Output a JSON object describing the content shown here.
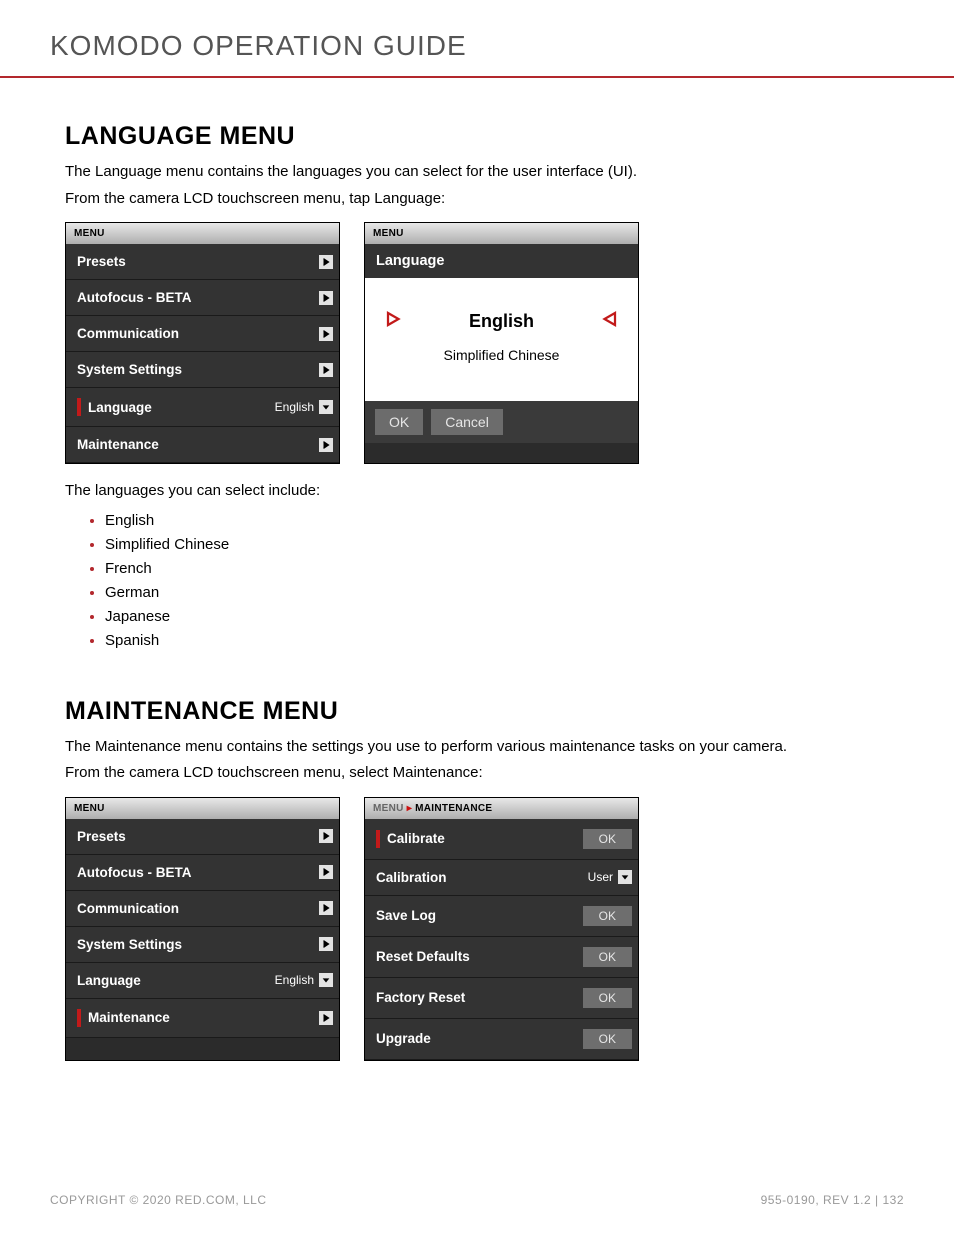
{
  "header": {
    "title": "KOMODO OPERATION GUIDE"
  },
  "section1": {
    "heading": "LANGUAGE MENU",
    "p1": "The Language menu contains the languages you can select for the user interface (UI).",
    "p2": "From the camera LCD touchscreen menu, tap Language:",
    "listIntro": "The languages you can select include:",
    "items": [
      "English",
      "Simplified Chinese",
      "French",
      "German",
      "Japanese",
      "Spanish"
    ]
  },
  "menuShot": {
    "header": "MENU",
    "rows": [
      {
        "label": "Presets",
        "type": "arrow",
        "selected": false
      },
      {
        "label": "Autofocus - BETA",
        "type": "arrow",
        "selected": false
      },
      {
        "label": "Communication",
        "type": "arrow",
        "selected": false
      },
      {
        "label": "System Settings",
        "type": "arrow",
        "selected": false
      },
      {
        "label": "Language",
        "type": "dropdown",
        "value": "English",
        "selected": true
      },
      {
        "label": "Maintenance",
        "type": "arrow",
        "selected": false
      }
    ]
  },
  "langDetail": {
    "header": "MENU",
    "title": "Language",
    "main": "English",
    "sub": "Simplified Chinese",
    "ok": "OK",
    "cancel": "Cancel"
  },
  "section2": {
    "heading": "MAINTENANCE MENU",
    "p1": "The Maintenance menu contains the settings you use to perform various maintenance tasks on your camera.",
    "p2": "From the camera LCD touchscreen menu, select Maintenance:"
  },
  "menuShot2": {
    "header": "MENU",
    "rows": [
      {
        "label": "Presets",
        "type": "arrow",
        "selected": false
      },
      {
        "label": "Autofocus - BETA",
        "type": "arrow",
        "selected": false
      },
      {
        "label": "Communication",
        "type": "arrow",
        "selected": false
      },
      {
        "label": "System Settings",
        "type": "arrow",
        "selected": false
      },
      {
        "label": "Language",
        "type": "dropdown",
        "value": "English",
        "selected": false
      },
      {
        "label": "Maintenance",
        "type": "arrow",
        "selected": true
      }
    ]
  },
  "maintDetail": {
    "crumbRoot": "MENU",
    "crumbLeaf": "MAINTENANCE",
    "rows": [
      {
        "label": "Calibrate",
        "type": "ok",
        "value": "OK",
        "selected": true
      },
      {
        "label": "Calibration",
        "type": "dropdown",
        "value": "User",
        "selected": false
      },
      {
        "label": "Save Log",
        "type": "ok",
        "value": "OK",
        "selected": false
      },
      {
        "label": "Reset Defaults",
        "type": "ok",
        "value": "OK",
        "selected": false
      },
      {
        "label": "Factory Reset",
        "type": "ok",
        "value": "OK",
        "selected": false
      },
      {
        "label": "Upgrade",
        "type": "ok",
        "value": "OK",
        "selected": false
      }
    ]
  },
  "footer": {
    "left": "COPYRIGHT © 2020 RED.COM, LLC",
    "right": "955-0190, REV 1.2  |  132"
  }
}
